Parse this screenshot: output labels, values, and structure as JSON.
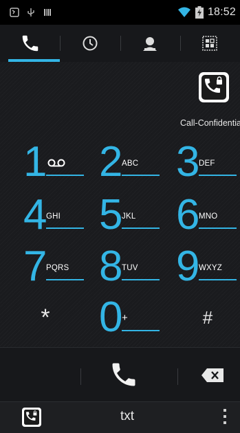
{
  "status_bar": {
    "time": "18:52",
    "icons": [
      "caller-app-icon",
      "usb-icon",
      "barcode-icon",
      "wifi-icon",
      "battery-icon"
    ]
  },
  "tabs": [
    {
      "name": "phone",
      "icon": "phone-icon",
      "active": true
    },
    {
      "name": "recent",
      "icon": "clock-icon",
      "active": false
    },
    {
      "name": "contacts",
      "icon": "person-icon",
      "active": false
    },
    {
      "name": "groups",
      "icon": "grid-icon",
      "active": false
    }
  ],
  "account": {
    "label": "Call-Confidential",
    "icon": "lock-phone-icon"
  },
  "dialpad": {
    "keys": [
      {
        "digit": "1",
        "letters": ""
      },
      {
        "digit": "2",
        "letters": "ABC"
      },
      {
        "digit": "3",
        "letters": "DEF"
      },
      {
        "digit": "4",
        "letters": "GHI"
      },
      {
        "digit": "5",
        "letters": "JKL"
      },
      {
        "digit": "6",
        "letters": "MNO"
      },
      {
        "digit": "7",
        "letters": "PQRS"
      },
      {
        "digit": "8",
        "letters": "TUV"
      },
      {
        "digit": "9",
        "letters": "WXYZ"
      },
      {
        "digit": "*",
        "letters": ""
      },
      {
        "digit": "0",
        "letters": "+"
      },
      {
        "digit": "#",
        "letters": ""
      }
    ]
  },
  "actions": {
    "call_icon": "phone-call-icon",
    "delete_icon": "backspace-icon"
  },
  "bottom_bar": {
    "label": "txt",
    "app_icon": "lock-phone-icon",
    "menu_icon": "overflow-menu-icon"
  },
  "colors": {
    "accent": "#33b5e5",
    "background": "#1a1b1e"
  }
}
